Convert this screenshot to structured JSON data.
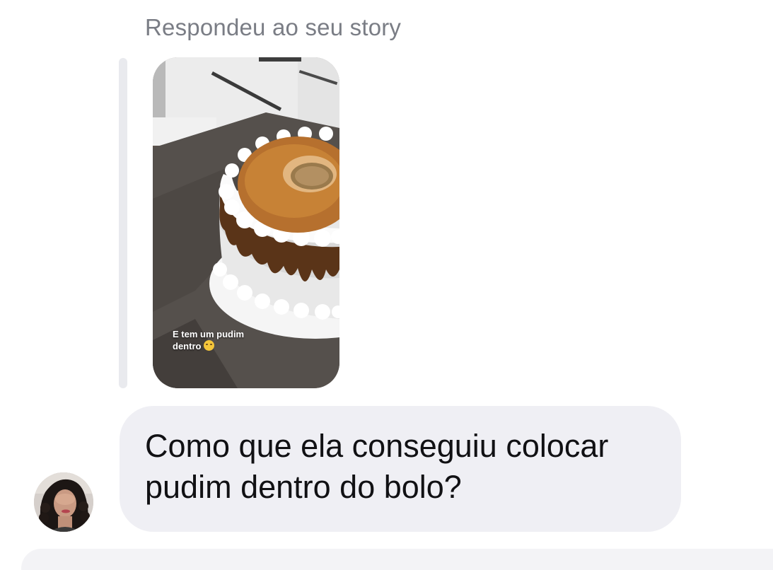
{
  "reply_header": {
    "label": "Respondeu ao seu story"
  },
  "story": {
    "caption_line1": "E tem um pudim",
    "caption_line2": "dentro",
    "caption_emoji": "upside-down-smiley-icon"
  },
  "message": {
    "line1": "Como que ela conseguiu colocar",
    "line2": "pudim dentro do bolo?"
  },
  "sender": {
    "avatar_icon": "profile-photo-avatar"
  },
  "colors": {
    "bubble": "#efeff4",
    "quote_bar": "#e9eaee",
    "muted_text": "#7a7d85",
    "message_text": "#111114"
  }
}
